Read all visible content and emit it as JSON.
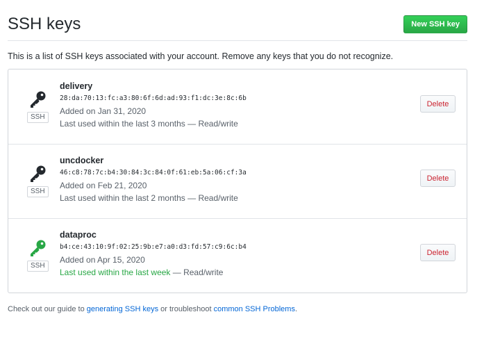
{
  "header": {
    "title": "SSH keys",
    "new_key_label": "New SSH key"
  },
  "intro_text": "This is a list of SSH keys associated with your account. Remove any keys that you do not recognize.",
  "keys": [
    {
      "title": "delivery",
      "fingerprint": "28:da:70:13:fc:a3:80:6f:6d:ad:93:f1:dc:3e:8c:6b",
      "added": "Added on Jan 31, 2020",
      "last_used": "Last used within the last 3 months",
      "last_used_suffix": " — Read/write",
      "recent": false,
      "type_label": "SSH",
      "icon_color": "#24292e",
      "delete_label": "Delete"
    },
    {
      "title": "uncdocker",
      "fingerprint": "46:c8:78:7c:b4:30:84:3c:84:0f:61:eb:5a:06:cf:3a",
      "added": "Added on Feb 21, 2020",
      "last_used": "Last used within the last 2 months",
      "last_used_suffix": " — Read/write",
      "recent": false,
      "type_label": "SSH",
      "icon_color": "#24292e",
      "delete_label": "Delete"
    },
    {
      "title": "dataproc",
      "fingerprint": "b4:ce:43:10:9f:02:25:9b:e7:a0:d3:fd:57:c9:6c:b4",
      "added": "Added on Apr 15, 2020",
      "last_used": "Last used within the last week",
      "last_used_suffix": " — Read/write",
      "recent": true,
      "type_label": "SSH",
      "icon_color": "#28a745",
      "delete_label": "Delete"
    }
  ],
  "footer": {
    "prefix": "Check out our guide to ",
    "link1": "generating SSH keys",
    "middle": " or troubleshoot ",
    "link2": "common SSH Problems",
    "suffix": "."
  },
  "colors": {
    "primary_button": "#28a745",
    "danger": "#cb2431",
    "link": "#0366d6",
    "recent": "#28a745"
  }
}
